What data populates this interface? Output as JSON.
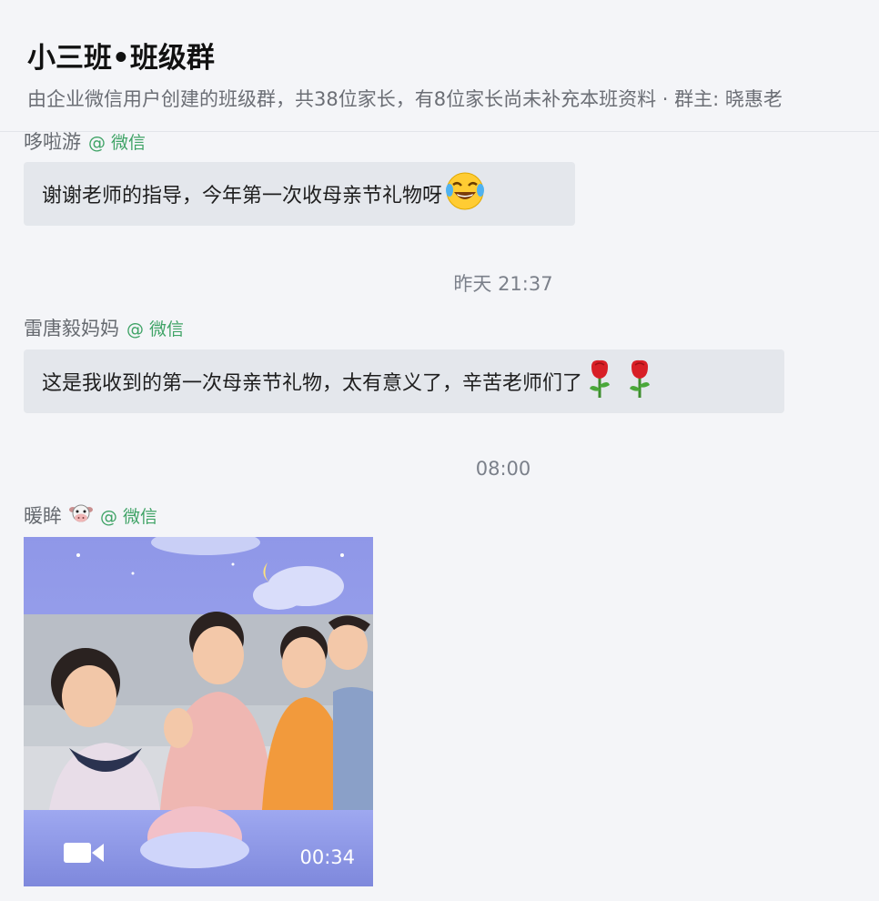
{
  "header": {
    "title": "小三班•班级群",
    "subtitle": "由企业微信用户创建的班级群，共38位家长，有8位家长尚未补充本班资料 · 群主: 晓惠老"
  },
  "messages": [
    {
      "sender": "哆啦游",
      "source": "@ 微信",
      "text": "谢谢老师的指导，今年第一次收母亲节礼物呀",
      "emoji_icons": [
        "laughing-tears-emoji"
      ]
    },
    {
      "timestamp": "昨天 21:37"
    },
    {
      "sender": "雷唐毅妈妈",
      "source": "@ 微信",
      "text": "这是我收到的第一次母亲节礼物，太有意义了，辛苦老师们了",
      "emoji_icons": [
        "rose-emoji",
        "rose-emoji"
      ]
    },
    {
      "timestamp": "08:00"
    },
    {
      "sender": "暖眸",
      "sender_icon": "cow-face-emoji",
      "source": "@ 微信",
      "video": {
        "duration": "00:34",
        "icon": "video-camera-icon"
      }
    }
  ],
  "colors": {
    "background": "#f4f5f8",
    "bubble": "#e4e7ec",
    "source_green": "#3fa366",
    "timestamp": "#7b808a"
  }
}
